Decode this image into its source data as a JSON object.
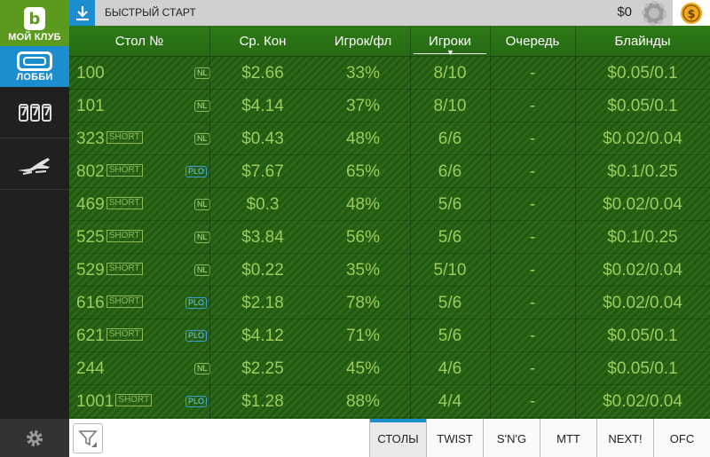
{
  "sidebar": {
    "club_logo": "b",
    "club_label": "МОЙ КЛУБ",
    "lobby_label": "ЛОББИ",
    "slots_digits": [
      "7",
      "7",
      "7"
    ]
  },
  "topbar": {
    "quick_start_label": "БЫСТРЫЙ СТАРТ",
    "balance": "$0"
  },
  "table": {
    "headers": {
      "table_no": "Стол №",
      "avg_pot": "Ср. Кон",
      "players_flop": "Игрок/фл",
      "players": "Игроки",
      "queue": "Очередь",
      "blinds": "Блайнды"
    },
    "sorted_by": "players",
    "rows": [
      {
        "id": "100",
        "short": "",
        "game": "NL",
        "pot": "$2.66",
        "flop": "33%",
        "players": "8/10",
        "queue": "-",
        "blinds": "$0.05/0.1"
      },
      {
        "id": "101",
        "short": "",
        "game": "NL",
        "pot": "$4.14",
        "flop": "37%",
        "players": "8/10",
        "queue": "-",
        "blinds": "$0.05/0.1"
      },
      {
        "id": "323",
        "short": "SHORT",
        "game": "NL",
        "pot": "$0.43",
        "flop": "48%",
        "players": "6/6",
        "queue": "-",
        "blinds": "$0.02/0.04"
      },
      {
        "id": "802",
        "short": "SHORT",
        "game": "PLO",
        "pot": "$7.67",
        "flop": "65%",
        "players": "6/6",
        "queue": "-",
        "blinds": "$0.1/0.25"
      },
      {
        "id": "469",
        "short": "SHORT",
        "game": "NL",
        "pot": "$0.3",
        "flop": "48%",
        "players": "5/6",
        "queue": "-",
        "blinds": "$0.02/0.04"
      },
      {
        "id": "525",
        "short": "SHORT",
        "game": "NL",
        "pot": "$3.84",
        "flop": "56%",
        "players": "5/6",
        "queue": "-",
        "blinds": "$0.1/0.25"
      },
      {
        "id": "529",
        "short": "SHORT",
        "game": "NL",
        "pot": "$0.22",
        "flop": "35%",
        "players": "5/10",
        "queue": "-",
        "blinds": "$0.02/0.04"
      },
      {
        "id": "616",
        "short": "SHORT",
        "game": "PLO",
        "pot": "$2.18",
        "flop": "78%",
        "players": "5/6",
        "queue": "-",
        "blinds": "$0.02/0.04"
      },
      {
        "id": "621",
        "short": "SHORT",
        "game": "PLO",
        "pot": "$4.12",
        "flop": "71%",
        "players": "5/6",
        "queue": "-",
        "blinds": "$0.05/0.1"
      },
      {
        "id": "244",
        "short": "",
        "game": "NL",
        "pot": "$2.25",
        "flop": "45%",
        "players": "4/6",
        "queue": "-",
        "blinds": "$0.05/0.1"
      },
      {
        "id": "1001",
        "short": "SHORT",
        "game": "PLO",
        "pot": "$1.28",
        "flop": "88%",
        "players": "4/4",
        "queue": "-",
        "blinds": "$0.02/0.04"
      }
    ]
  },
  "bottom_tabs": [
    {
      "label": "СТОЛЫ",
      "active": true
    },
    {
      "label": "TWIST",
      "active": false
    },
    {
      "label": "S'N'G",
      "active": false
    },
    {
      "label": "MTT",
      "active": false
    },
    {
      "label": "NEXT!",
      "active": false
    },
    {
      "label": "OFC",
      "active": false
    }
  ],
  "colors": {
    "brand_green": "#5c9a1e",
    "accent_blue": "#1c8ed0",
    "row_text": "#9ccc5a",
    "coin_gold": "#f0a81c"
  }
}
